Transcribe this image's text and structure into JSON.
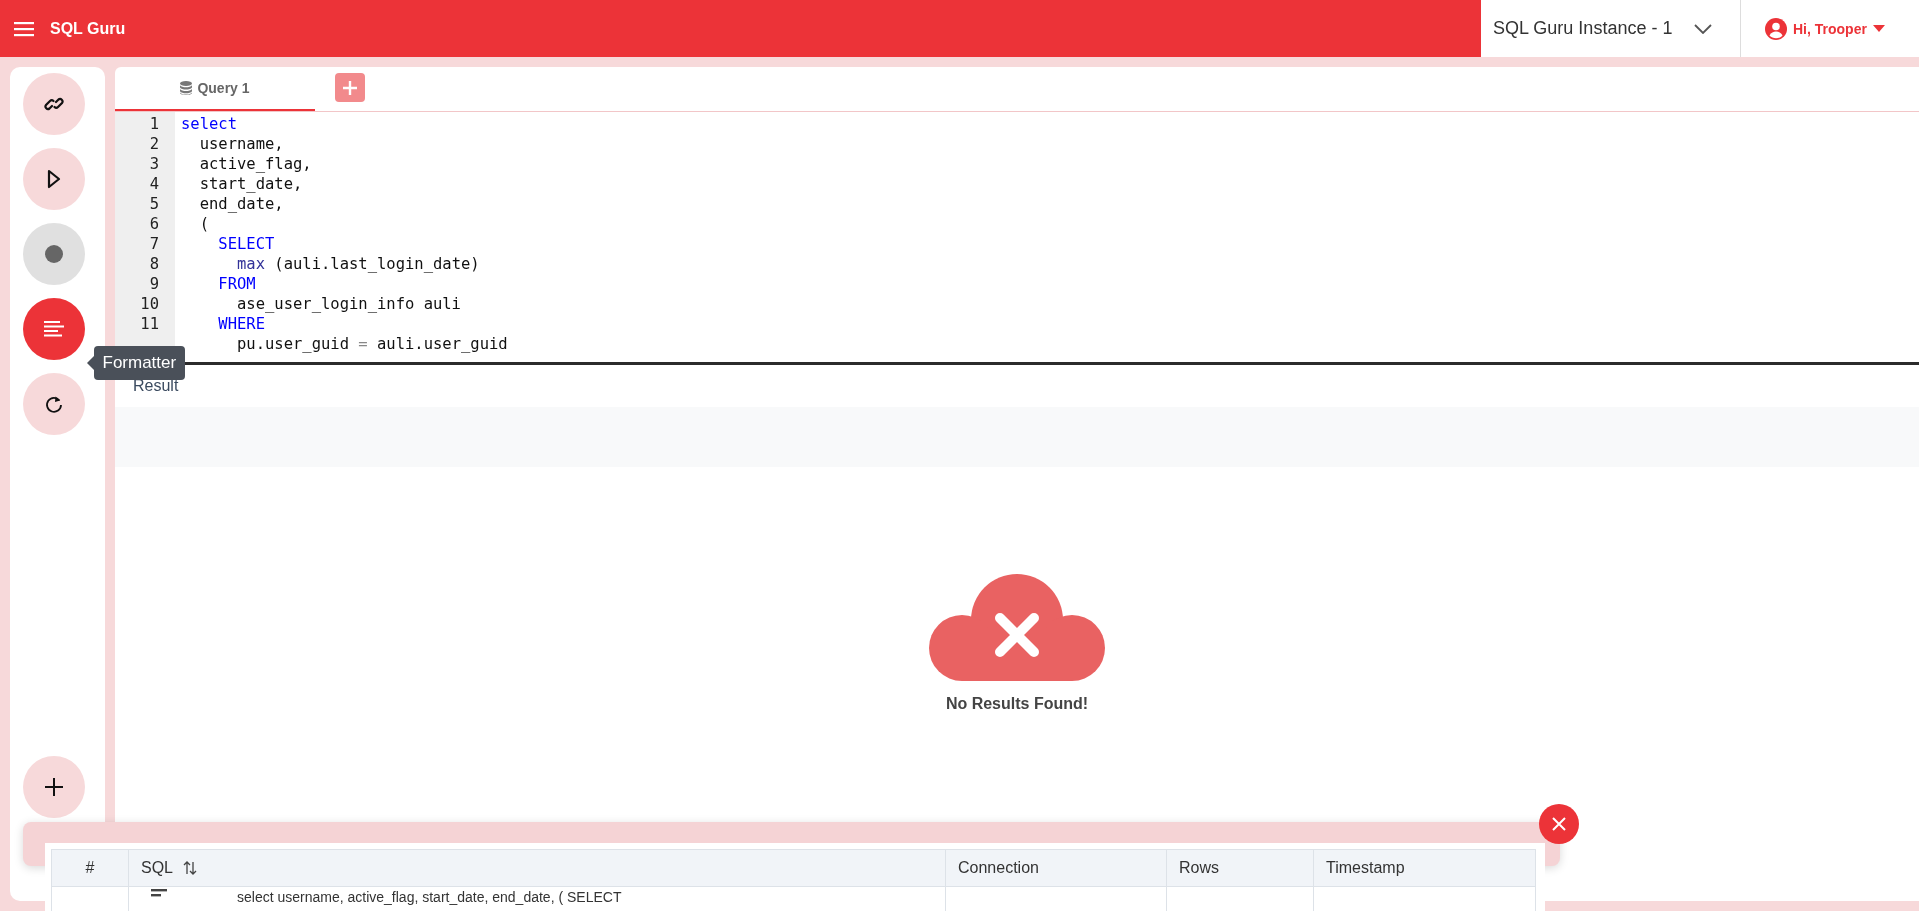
{
  "header": {
    "title": "SQL Guru",
    "instance": "SQL Guru Instance - 1",
    "user": "Hi, Trooper"
  },
  "sidebar": {
    "buttons": [
      {
        "kind": "link",
        "active": false,
        "disabled": false
      },
      {
        "kind": "run",
        "active": false,
        "disabled": false
      },
      {
        "kind": "stop",
        "active": false,
        "disabled": true
      },
      {
        "kind": "format",
        "active": true,
        "disabled": false
      },
      {
        "kind": "refresh",
        "active": false,
        "disabled": false
      }
    ],
    "tooltip": "Formatter",
    "bottom_button": {
      "kind": "add",
      "active": false,
      "disabled": false
    }
  },
  "tabs": [
    {
      "label": "Query 1",
      "selected": true
    }
  ],
  "editor": {
    "lines": [
      {
        "number": "1",
        "tokens": [
          {
            "kind": "keyword",
            "text": "select"
          }
        ]
      },
      {
        "number": "2",
        "tokens": [
          {
            "kind": "plain",
            "text": "  username,"
          }
        ]
      },
      {
        "number": "3",
        "tokens": [
          {
            "kind": "plain",
            "text": "  active_flag,"
          }
        ]
      },
      {
        "number": "4",
        "tokens": [
          {
            "kind": "plain",
            "text": "  start_date,"
          }
        ]
      },
      {
        "number": "5",
        "tokens": [
          {
            "kind": "plain",
            "text": "  end_date,"
          }
        ]
      },
      {
        "number": "6",
        "tokens": [
          {
            "kind": "plain",
            "text": "  ("
          }
        ]
      },
      {
        "number": "7",
        "tokens": [
          {
            "kind": "keyword",
            "text": "    SELECT"
          }
        ]
      },
      {
        "number": "8",
        "tokens": [
          {
            "kind": "function",
            "text": "      max"
          },
          {
            "kind": "plain",
            "text": " (auli.last_login_date)"
          }
        ]
      },
      {
        "number": "9",
        "tokens": [
          {
            "kind": "keyword",
            "text": "    FROM"
          }
        ]
      },
      {
        "number": "10",
        "tokens": [
          {
            "kind": "plain",
            "text": "      ase_user_login_info auli"
          }
        ]
      },
      {
        "number": "11",
        "tokens": [
          {
            "kind": "keyword",
            "text": "    WHERE"
          }
        ]
      },
      {
        "tokens": [
          {
            "kind": "plain",
            "text": "      pu.user_guid "
          },
          {
            "kind": "operator",
            "text": "="
          },
          {
            "kind": "plain",
            "text": " auli.user_guid"
          }
        ]
      }
    ]
  },
  "result": {
    "title": "Result",
    "empty_message": "No Results Found!"
  },
  "history": {
    "columns": [
      "#",
      "SQL",
      "Connection",
      "Rows",
      "Timestamp"
    ],
    "rows": [
      {
        "sql": "select username, active_flag, start_date, end_date, ( SELECT"
      }
    ]
  }
}
